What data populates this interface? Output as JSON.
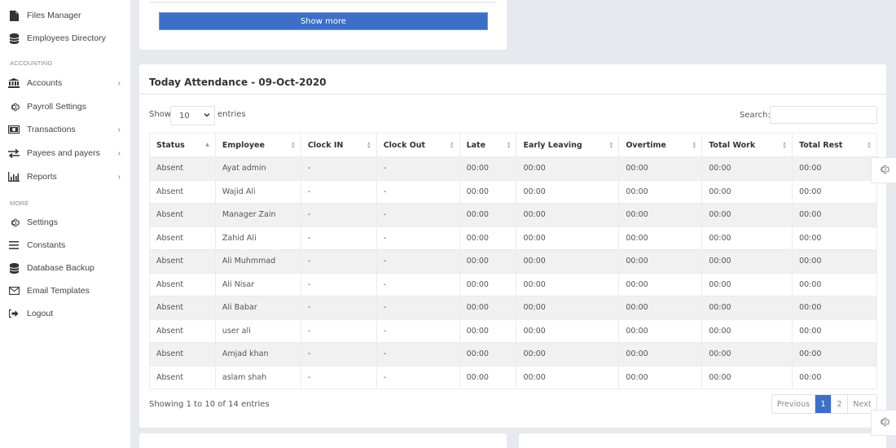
{
  "sidebar": {
    "items": [
      {
        "label": "Files Manager",
        "icon": "file-icon",
        "has_children": false
      },
      {
        "label": "Employees Directory",
        "icon": "database-icon",
        "has_children": false
      }
    ],
    "sections": [
      {
        "title": "ACCOUNTING",
        "items": [
          {
            "label": "Accounts",
            "icon": "bank-icon",
            "has_children": true
          },
          {
            "label": "Payroll Settings",
            "icon": "gear-icon",
            "has_children": false
          },
          {
            "label": "Transactions",
            "icon": "money-icon",
            "has_children": true
          },
          {
            "label": "Payees and payers",
            "icon": "exchange-icon",
            "has_children": true
          },
          {
            "label": "Reports",
            "icon": "bar-chart-icon",
            "has_children": true
          }
        ]
      },
      {
        "title": "MORE",
        "items": [
          {
            "label": "Settings",
            "icon": "gear-icon",
            "has_children": false
          },
          {
            "label": "Constants",
            "icon": "list-icon",
            "has_children": false
          },
          {
            "label": "Database Backup",
            "icon": "database-icon",
            "has_children": false
          },
          {
            "label": "Email Templates",
            "icon": "envelope-icon",
            "has_children": false
          },
          {
            "label": "Logout",
            "icon": "logout-icon",
            "has_children": false
          }
        ]
      }
    ]
  },
  "top_card": {
    "show_more_label": "Show more"
  },
  "attendance": {
    "title": "Today Attendance - 09-Oct-2020",
    "show_label": "Show",
    "entries_label": "entries",
    "page_length": "10",
    "search_label": "Search:",
    "search_value": "",
    "columns": [
      "Status",
      "Employee",
      "Clock IN",
      "Clock Out",
      "Late",
      "Early Leaving",
      "Overtime",
      "Total Work",
      "Total Rest"
    ],
    "sorted_column": "Status",
    "rows": [
      [
        "Absent",
        "Ayat admin",
        "-",
        "-",
        "00:00",
        "00:00",
        "00:00",
        "00:00",
        "00:00"
      ],
      [
        "Absent",
        "Wajid Ali",
        "-",
        "-",
        "00:00",
        "00:00",
        "00:00",
        "00:00",
        "00:00"
      ],
      [
        "Absent",
        "Manager Zain",
        "-",
        "-",
        "00:00",
        "00:00",
        "00:00",
        "00:00",
        "00:00"
      ],
      [
        "Absent",
        "Zahid Ali",
        "-",
        "-",
        "00:00",
        "00:00",
        "00:00",
        "00:00",
        "00:00"
      ],
      [
        "Absent",
        "Ali Muhmmad",
        "-",
        "-",
        "00:00",
        "00:00",
        "00:00",
        "00:00",
        "00:00"
      ],
      [
        "Absent",
        "Ali Nisar",
        "-",
        "-",
        "00:00",
        "00:00",
        "00:00",
        "00:00",
        "00:00"
      ],
      [
        "Absent",
        "Ali Babar",
        "-",
        "-",
        "00:00",
        "00:00",
        "00:00",
        "00:00",
        "00:00"
      ],
      [
        "Absent",
        "user ali",
        "-",
        "-",
        "00:00",
        "00:00",
        "00:00",
        "00:00",
        "00:00"
      ],
      [
        "Absent",
        "Amjad khan",
        "-",
        "-",
        "00:00",
        "00:00",
        "00:00",
        "00:00",
        "00:00"
      ],
      [
        "Absent",
        "aslam shah",
        "-",
        "-",
        "00:00",
        "00:00",
        "00:00",
        "00:00",
        "00:00"
      ]
    ],
    "info": "Showing 1 to 10 of 14 entries",
    "pagination": {
      "previous": "Previous",
      "pages": [
        "1",
        "2"
      ],
      "current_page": "1",
      "next": "Next"
    }
  },
  "colors": {
    "accent": "#3d6fc6",
    "background": "#e6e9ee",
    "row_stripe": "#f1f1f1"
  }
}
